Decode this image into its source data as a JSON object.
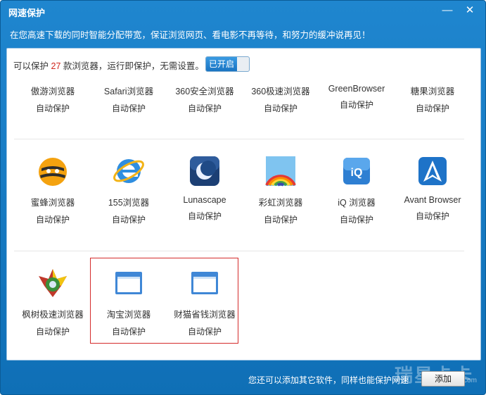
{
  "window": {
    "title": "网速保护",
    "min_glyph": "—",
    "close_glyph": "✕"
  },
  "banner": "在您高速下载的同时智能分配带宽，保证浏览网页、看电影不再等待，和努力的缓冲说再见！",
  "summary": {
    "prefix": "可以保护",
    "count": "27",
    "suffix": "款浏览器，运行即保护，无需设置。"
  },
  "toggle": {
    "label": "已开启",
    "state": "on"
  },
  "rows": [
    [
      {
        "name": "傲游浏览器",
        "status": "自动保护",
        "icon": "maxthon-icon"
      },
      {
        "name": "Safari浏览器",
        "status": "自动保护",
        "icon": "safari-icon"
      },
      {
        "name": "360安全浏览器",
        "status": "自动保护",
        "icon": "360se-icon"
      },
      {
        "name": "360极速浏览器",
        "status": "自动保护",
        "icon": "360chrome-icon"
      },
      {
        "name": "GreenBrowser",
        "status": "自动保护",
        "icon": "greenbrowser-icon"
      },
      {
        "name": "糖果浏览器",
        "status": "自动保护",
        "icon": "candy-icon"
      }
    ],
    [
      {
        "name": "蜜蜂浏览器",
        "status": "自动保护",
        "icon": "bee-icon"
      },
      {
        "name": "155浏览器",
        "status": "自动保护",
        "icon": "ie-e-icon"
      },
      {
        "name": "Lunascape",
        "status": "自动保护",
        "icon": "moon-icon"
      },
      {
        "name": "彩虹浏览器",
        "status": "自动保护",
        "icon": "rainbow-icon"
      },
      {
        "name": "iQ 浏览器",
        "status": "自动保护",
        "icon": "iq-icon"
      },
      {
        "name": "Avant Browser",
        "status": "自动保护",
        "icon": "avant-icon"
      }
    ],
    [
      {
        "name": "枫树极速浏览器",
        "status": "自动保护",
        "icon": "maple-icon"
      },
      {
        "name": "淘宝浏览器",
        "status": "自动保护",
        "icon": "window-icon"
      },
      {
        "name": "财猫省钱浏览器",
        "status": "自动保护",
        "icon": "window-icon"
      }
    ]
  ],
  "footer": {
    "text": "您还可以添加其它软件，同样也能保护网速",
    "add_label": "添加"
  },
  "watermark": {
    "main": "瑞星卡卡",
    "sub": "www.ikaka.com"
  },
  "colors": {
    "title_bg": "#1a7fc8",
    "count": "#d0261c",
    "highlight": "#d42b2b",
    "toggle_on": "#2a88d6"
  }
}
